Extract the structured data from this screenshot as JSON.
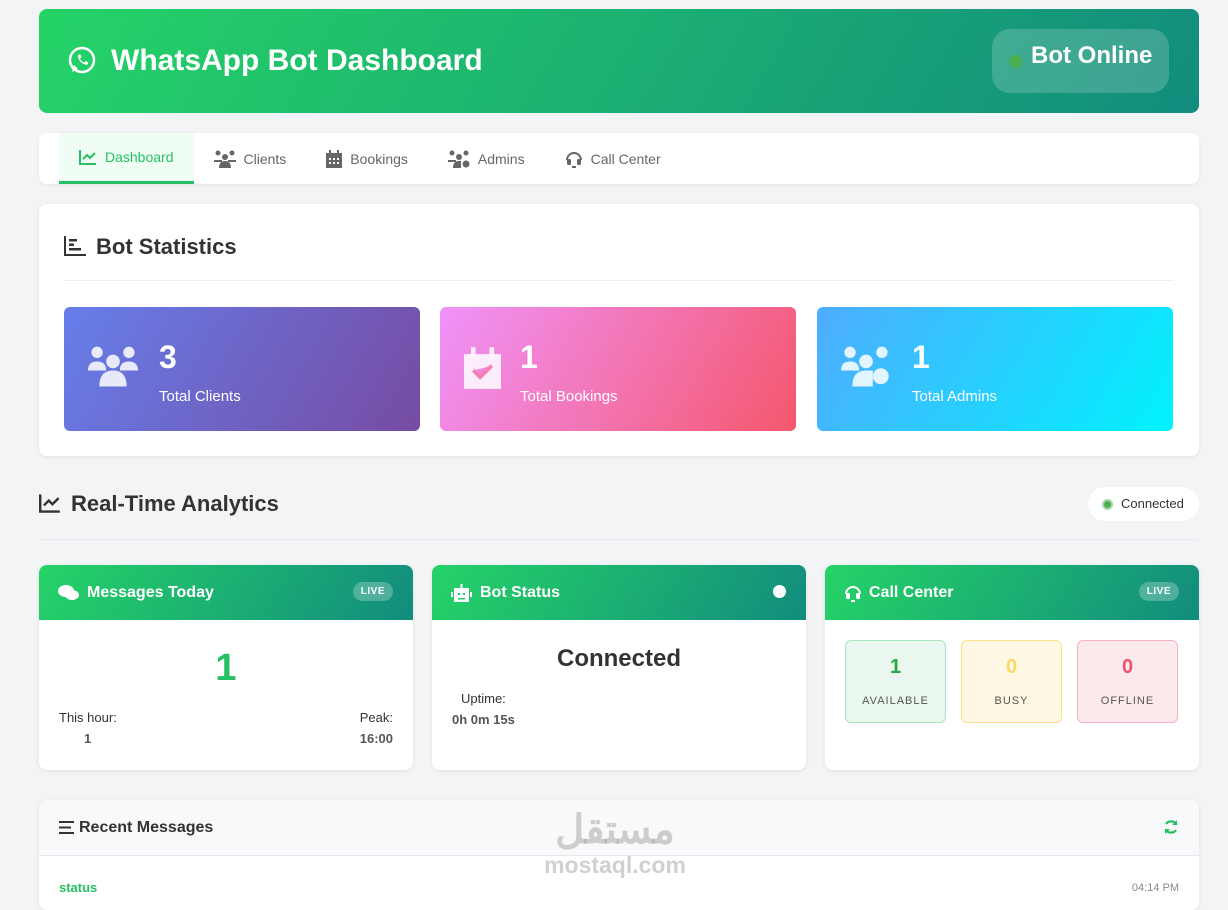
{
  "header": {
    "title": "WhatsApp Bot Dashboard",
    "status": "Bot Online"
  },
  "nav": {
    "tabs": [
      {
        "label": "Dashboard"
      },
      {
        "label": "Clients"
      },
      {
        "label": "Bookings"
      },
      {
        "label": "Admins"
      },
      {
        "label": "Call Center"
      }
    ]
  },
  "stats": {
    "title": "Bot Statistics",
    "cards": [
      {
        "value": "3",
        "label": "Total Clients"
      },
      {
        "value": "1",
        "label": "Total Bookings"
      },
      {
        "value": "1",
        "label": "Total Admins"
      }
    ]
  },
  "analytics": {
    "title": "Real-Time Analytics",
    "connection": "Connected"
  },
  "messages_today": {
    "title": "Messages Today",
    "badge": "LIVE",
    "count": "1",
    "this_hour_label": "This hour:",
    "this_hour": "1",
    "peak_label": "Peak:",
    "peak": "16:00"
  },
  "bot_status": {
    "title": "Bot Status",
    "status": "Connected",
    "uptime_label": "Uptime:",
    "uptime": "0h 0m 15s"
  },
  "call_center": {
    "title": "Call Center",
    "badge": "LIVE",
    "available": "1",
    "available_label": "AVAILABLE",
    "busy": "0",
    "busy_label": "BUSY",
    "offline": "0",
    "offline_label": "OFFLINE"
  },
  "recent": {
    "title": "Recent Messages",
    "items": [
      {
        "type": "status",
        "time": "04:14 PM"
      }
    ]
  },
  "watermark": {
    "arabic": "مستقل",
    "latin": "mostaql.com"
  }
}
